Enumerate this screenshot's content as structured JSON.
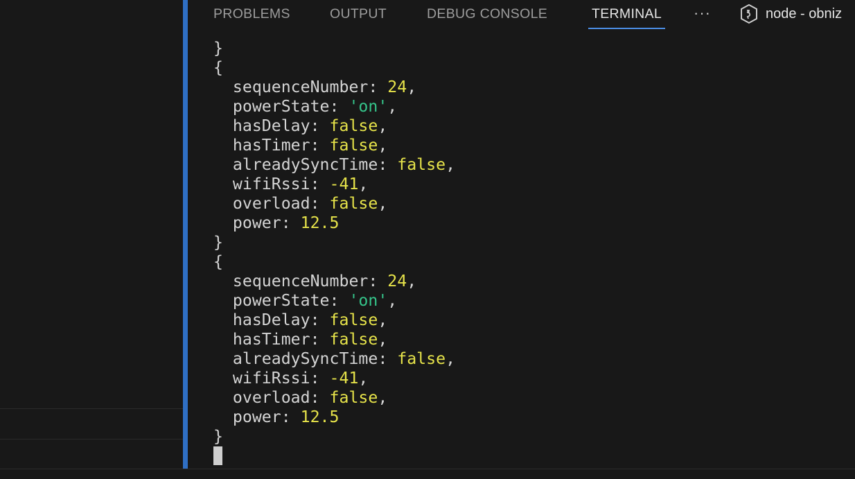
{
  "panel": {
    "tabs": [
      {
        "label": "PROBLEMS"
      },
      {
        "label": "OUTPUT"
      },
      {
        "label": "DEBUG CONSOLE"
      },
      {
        "label": "TERMINAL",
        "active": true
      }
    ],
    "more_label": "···",
    "terminal_name": "node - obniz"
  },
  "terminal": {
    "lines": [
      [
        {
          "t": "}"
        }
      ],
      [
        {
          "t": "{"
        }
      ],
      [
        {
          "t": "  sequenceNumber: "
        },
        {
          "t": "24",
          "c": "num"
        },
        {
          "t": ","
        }
      ],
      [
        {
          "t": "  powerState: "
        },
        {
          "t": "'on'",
          "c": "str"
        },
        {
          "t": ","
        }
      ],
      [
        {
          "t": "  hasDelay: "
        },
        {
          "t": "false",
          "c": "bool"
        },
        {
          "t": ","
        }
      ],
      [
        {
          "t": "  hasTimer: "
        },
        {
          "t": "false",
          "c": "bool"
        },
        {
          "t": ","
        }
      ],
      [
        {
          "t": "  alreadySyncTime: "
        },
        {
          "t": "false",
          "c": "bool"
        },
        {
          "t": ","
        }
      ],
      [
        {
          "t": "  wifiRssi: "
        },
        {
          "t": "-41",
          "c": "num"
        },
        {
          "t": ","
        }
      ],
      [
        {
          "t": "  overload: "
        },
        {
          "t": "false",
          "c": "bool"
        },
        {
          "t": ","
        }
      ],
      [
        {
          "t": "  power: "
        },
        {
          "t": "12.5",
          "c": "num"
        }
      ],
      [
        {
          "t": "}"
        }
      ],
      [
        {
          "t": "{"
        }
      ],
      [
        {
          "t": "  sequenceNumber: "
        },
        {
          "t": "24",
          "c": "num"
        },
        {
          "t": ","
        }
      ],
      [
        {
          "t": "  powerState: "
        },
        {
          "t": "'on'",
          "c": "str"
        },
        {
          "t": ","
        }
      ],
      [
        {
          "t": "  hasDelay: "
        },
        {
          "t": "false",
          "c": "bool"
        },
        {
          "t": ","
        }
      ],
      [
        {
          "t": "  hasTimer: "
        },
        {
          "t": "false",
          "c": "bool"
        },
        {
          "t": ","
        }
      ],
      [
        {
          "t": "  alreadySyncTime: "
        },
        {
          "t": "false",
          "c": "bool"
        },
        {
          "t": ","
        }
      ],
      [
        {
          "t": "  wifiRssi: "
        },
        {
          "t": "-41",
          "c": "num"
        },
        {
          "t": ","
        }
      ],
      [
        {
          "t": "  overload: "
        },
        {
          "t": "false",
          "c": "bool"
        },
        {
          "t": ","
        }
      ],
      [
        {
          "t": "  power: "
        },
        {
          "t": "12.5",
          "c": "num"
        }
      ],
      [
        {
          "t": "}"
        }
      ]
    ]
  },
  "colors": {
    "background": "#181818",
    "accent": "#2f6fc4",
    "number": "#e6e34a",
    "string": "#35c48a",
    "text": "#d4d4d4"
  },
  "icons": {
    "terminal": "terminal-shell-icon",
    "more": "more-actions-icon"
  }
}
